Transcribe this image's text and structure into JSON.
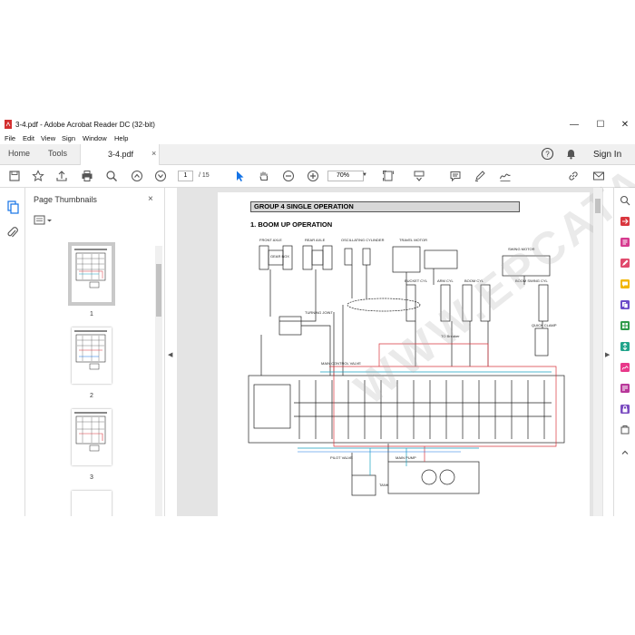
{
  "window": {
    "title": "3-4.pdf - Adobe Acrobat Reader DC (32-bit)",
    "minimize": "—",
    "maximize": "☐",
    "close": "✕"
  },
  "menu": [
    "File",
    "Edit",
    "View",
    "Sign",
    "Window",
    "Help"
  ],
  "tabs": {
    "home": "Home",
    "tools": "Tools",
    "document": "3-4.pdf",
    "close": "×",
    "sign_in": "Sign In"
  },
  "toolbar": {
    "page_current": "1",
    "page_total": "/ 15",
    "zoom": "70%"
  },
  "side_panel": {
    "title": "Page Thumbnails",
    "close": "×",
    "pages": [
      "1",
      "2",
      "3"
    ]
  },
  "document": {
    "heading": "GROUP 4  SINGLE OPERATION",
    "subheading": "1. BOOM UP OPERATION",
    "watermark": "WWW.EPCATA.COM",
    "labels": {
      "front_axle": "FRONT AXLE",
      "rear_axle": "REAR AXLE",
      "oscillating": "OSCILLATING CYLINDER",
      "travel_motor": "TRAVEL MOTOR",
      "swing_motor": "SWING MOTOR",
      "gear_box": "GEAR BOX",
      "turning_joint": "TURNING JOINT",
      "bucket_cyl": "BUCKET CYL",
      "arm_cyl": "ARM CYL",
      "boom_cyl": "BOOM CYL",
      "boom_swing_cyl": "BOOM SWING CYL",
      "quick_clamp": "QUICK CLAMP",
      "to_breaker": "TO Breaker",
      "main_control_valve": "MAIN CONTROL VALVE",
      "pilot_valve": "PILOT VALVE",
      "main_pump": "MAIN PUMP",
      "tank": "TANK"
    }
  },
  "colors": {
    "accent": "#1473e6",
    "red_line": "#d9363e",
    "cyan_line": "#18a0c0"
  }
}
